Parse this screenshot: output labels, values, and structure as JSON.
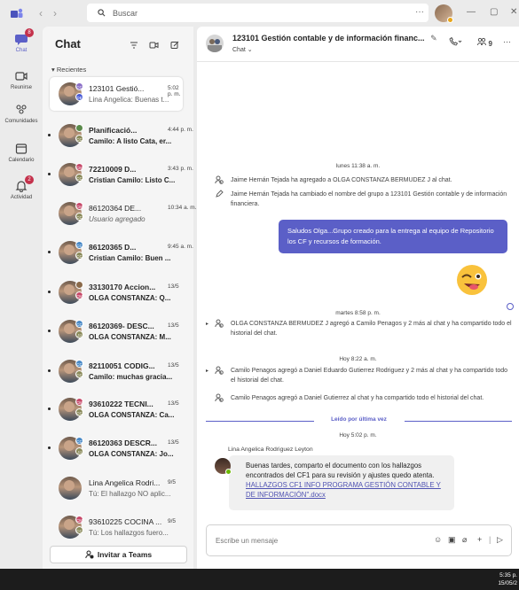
{
  "topbar": {
    "search_placeholder": "Buscar",
    "more": "···",
    "minimize": "—",
    "maximize": "▢",
    "close": "✕"
  },
  "rail": {
    "items": [
      {
        "label": "Chat",
        "badge": "8",
        "icon": "chat-icon"
      },
      {
        "label": "Reunirse",
        "badge": "",
        "icon": "video-icon"
      },
      {
        "label": "Comunidades",
        "badge": "",
        "icon": "people-icon"
      },
      {
        "label": "Calendario",
        "badge": "",
        "icon": "calendar-icon"
      },
      {
        "label": "Actividad",
        "badge": "2",
        "icon": "bell-icon"
      }
    ]
  },
  "chatlist": {
    "title": "Chat",
    "section": "Recientes",
    "invite": "Invitar a Teams",
    "items": [
      {
        "name": "123101 Gestió...",
        "time": "5:02 p. m.",
        "preview": "Lina Angelica: Buenas t...",
        "tags": [
          "CC",
          "DE"
        ],
        "tagcolors": [
          "#8a6ec7",
          "#4a5bd6"
        ],
        "unread": false,
        "selected": true
      },
      {
        "name": "Planificació...",
        "time": "4:44 p. m.",
        "preview": "Camilo: A listo Cata, er...",
        "tags": [
          "",
          "CC"
        ],
        "tagcolors": [
          "#5a8a4a",
          "#8a8a5a"
        ],
        "unread": true,
        "selected": false
      },
      {
        "name": "72210009 D...",
        "time": "3:43 p. m.",
        "preview": "Cristian Camilo: Listo C...",
        "tags": [
          "CM",
          "CC"
        ],
        "tagcolors": [
          "#c74a6a",
          "#8a8a5a"
        ],
        "unread": true,
        "selected": false
      },
      {
        "name": "86120364 DE...",
        "time": "10:34 a. m.",
        "preview": "Usuario agregado",
        "tags": [
          "CM",
          "CC"
        ],
        "tagcolors": [
          "#c74a6a",
          "#8a8a5a"
        ],
        "unread": false,
        "selected": false
      },
      {
        "name": "86120365 D...",
        "time": "9:45 a. m.",
        "preview": "Cristian Camilo: Buen ...",
        "tags": [
          "CC",
          "CC"
        ],
        "tagcolors": [
          "#4a8ac7",
          "#8a8a5a"
        ],
        "unread": true,
        "selected": false
      },
      {
        "name": "33130170 Accion...",
        "time": "13/5",
        "preview": "OLGA CONSTANZA: Q...",
        "tags": [
          "",
          "CM"
        ],
        "tagcolors": [
          "#8a6a4a",
          "#c74a6a"
        ],
        "unread": true,
        "selected": false
      },
      {
        "name": "86120369- DESC...",
        "time": "13/5",
        "preview": "OLGA CONSTANZA: M...",
        "tags": [
          "CC",
          "JJ"
        ],
        "tagcolors": [
          "#4a8ac7",
          "#8a8a5a"
        ],
        "unread": true,
        "selected": false
      },
      {
        "name": "82110051 CODIG...",
        "time": "13/5",
        "preview": "Camilo: muchas gracia...",
        "tags": [
          "CC",
          "CC"
        ],
        "tagcolors": [
          "#4a8ac7",
          "#8a8a5a"
        ],
        "unread": true,
        "selected": false
      },
      {
        "name": "93610222 TECNI...",
        "time": "13/5",
        "preview": "OLGA CONSTANZA: Ca...",
        "tags": [
          "CM",
          "CC"
        ],
        "tagcolors": [
          "#c74a6a",
          "#8a8a5a"
        ],
        "unread": true,
        "selected": false
      },
      {
        "name": "86120363 DESCR...",
        "time": "13/5",
        "preview": "OLGA CONSTANZA: Jo...",
        "tags": [
          "CC",
          "JJ"
        ],
        "tagcolors": [
          "#4a8ac7",
          "#8a8a5a"
        ],
        "unread": true,
        "selected": false
      },
      {
        "name": "Lina Angelica Rodri...",
        "time": "9/5",
        "preview": "Tú: El hallazgo NO aplic...",
        "tags": [
          "",
          ""
        ],
        "tagcolors": [
          "",
          ""
        ],
        "unread": false,
        "selected": false
      },
      {
        "name": "93610225 COCINA ...",
        "time": "9/5",
        "preview": "Tú: Los hallazgos fuero...",
        "tags": [
          "CM",
          "CC"
        ],
        "tagcolors": [
          "#c74a6a",
          "#8a8a5a"
        ],
        "unread": false,
        "selected": false
      }
    ]
  },
  "conversation": {
    "title": "123101 Gestión contable y de información financ...",
    "subtitle": "Chat",
    "participants": "9",
    "date1": "lunes 11:38 a. m.",
    "sys1": "Jaime Hernán Tejada ha agregado a OLGA CONSTANZA BERMUDEZ J al chat.",
    "sys2": "Jaime Hernán Tejada ha cambiado el nombre del grupo a 123101 Gestión contable y de información financiera.",
    "my_message": "Saludos Olga...Grupo creado para la entrega al equipo de Repositorio los CF y recursos de formación.",
    "date2": "martes 8:58 p. m.",
    "sys3": "OLGA CONSTANZA BERMUDEZ J agregó a Camilo Penagos y 2 más al chat y ha compartido todo el historial del chat.",
    "date3": "Hoy 8:22 a. m.",
    "sys4": "Camilo Penagos agregó a Daniel Eduardo Gutierrez Rodriguez y 2 más al chat y ha compartido todo el historial del chat.",
    "sys5": "Camilo Penagos agregó a Daniel Gutierrez al chat y ha compartido todo el historial del chat.",
    "last_read": "Leído por última vez",
    "date4": "Hoy 5:02 p. m.",
    "sender": "Lina Angelica Rodriguez Leyton",
    "recv_text": "Buenas tardes, comparto el documento con los hallazgos encontrados del CF1 para su revisión y ajustes quedo atenta.",
    "recv_link": "HALLAZGOS CF1 INFO PROGRAMA GESTIÓN CONTABLE Y DE INFORMACIÓN\".docx",
    "composer_placeholder": "Escribe un mensaje"
  },
  "taskbar": {
    "time": "5:35 p.",
    "date": "15/05/2"
  },
  "colors": {
    "accent": "#5b5fc7",
    "badge": "#c4314b",
    "available": "#6bb700"
  }
}
